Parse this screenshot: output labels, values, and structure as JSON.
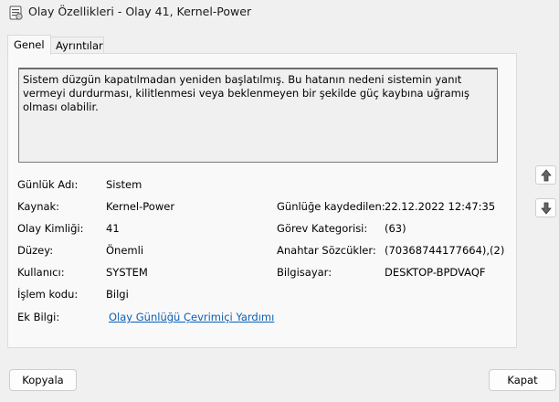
{
  "window": {
    "title": "Olay Özellikleri - Olay 41, Kernel-Power"
  },
  "tabs": [
    {
      "label": "Genel"
    },
    {
      "label": "Ayrıntılar"
    }
  ],
  "description": "Sistem düzgün kapatılmadan yeniden başlatılmış. Bu hatanın nedeni sistemin yanıt vermeyi durdurması, kilitlenmesi veya beklenmeyen bir şekilde güç kaybına uğramış olması olabilir.",
  "fields_left": [
    {
      "label": "Günlük Adı:",
      "value": "Sistem"
    },
    {
      "label": "Kaynak:",
      "value": "Kernel-Power"
    },
    {
      "label": "Olay Kimliği:",
      "value": "41"
    },
    {
      "label": "Düzey:",
      "value": "Önemli"
    },
    {
      "label": "Kullanıcı:",
      "value": "SYSTEM"
    },
    {
      "label": "İşlem kodu:",
      "value": "Bilgi"
    },
    {
      "label": "Ek Bilgi:",
      "value": "Olay Günlüğü Çevrimiçi Yardımı"
    }
  ],
  "fields_right": [
    {
      "label": "Günlüğe kaydedilen:",
      "value": "22.12.2022 12:47:35"
    },
    {
      "label": "Görev Kategorisi:",
      "value": "(63)"
    },
    {
      "label": "Anahtar Sözcükler:",
      "value": "(70368744177664),(2)"
    },
    {
      "label": "Bilgisayar:",
      "value": "DESKTOP-BPDVAQF"
    }
  ],
  "side_buttons": {
    "up_icon": "arrow-up-icon",
    "down_icon": "arrow-down-icon"
  },
  "buttons": {
    "copy": "Kopyala",
    "close": "Kapat"
  }
}
